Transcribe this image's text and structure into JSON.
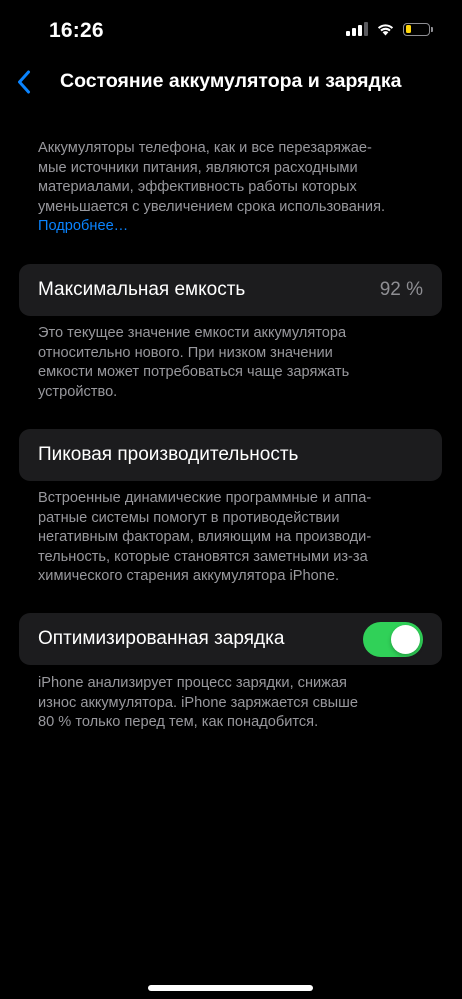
{
  "status_bar": {
    "time": "16:26",
    "battery_color": "#ffd60a",
    "battery_level": 0.25,
    "signal_bars_active": 3,
    "icons": [
      "signal-icon",
      "wifi-icon",
      "battery-icon"
    ]
  },
  "nav": {
    "back_icon": "chevron-left-icon",
    "title": "Состояние аккумулятора и зарядка"
  },
  "intro": {
    "lines": [
      "Аккумуляторы телефона, как и все перезаряжае-",
      "мые источники питания, являются расходными",
      "материалами, эффективность работы которых",
      "уменьшается с увеличением срока использования."
    ],
    "link": "Подробнее…"
  },
  "max_capacity": {
    "label": "Максимальная емкость",
    "value": "92 %",
    "description_lines": [
      "Это текущее значение емкости аккумулятора",
      "относительно нового. При низком значении",
      "емкости может потребоваться чаще заряжать",
      "устройство."
    ]
  },
  "peak_performance": {
    "label": "Пиковая производительность",
    "description_lines": [
      "Встроенные динамические программные и аппа-",
      "ратные системы помогут в противодействии",
      "негативным факторам, влияющим на производи-",
      "тельность, которые становятся заметными из-за",
      "химического старения аккумулятора iPhone."
    ]
  },
  "optimized_charging": {
    "label": "Оптимизированная зарядка",
    "enabled": true,
    "toggle_color": "#30d158",
    "description_lines": [
      "iPhone анализирует процесс зарядки, снижая",
      "износ аккумулятора. iPhone заряжается свыше",
      "80 % только перед тем, как понадобится."
    ]
  },
  "colors": {
    "background": "#000000",
    "cell": "#1c1c1e",
    "secondary_text": "#98989d",
    "link": "#0a84ff"
  }
}
